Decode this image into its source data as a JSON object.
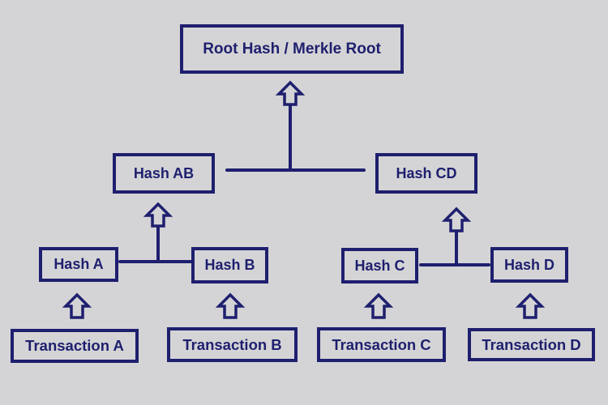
{
  "diagram": {
    "type": "merkle-tree",
    "colors": {
      "stroke": "#1e1f6e",
      "text": "#1e1f6e",
      "background": "#d4d4d6"
    },
    "nodes": {
      "root": "Root Hash / Merkle Root",
      "hash_ab": "Hash AB",
      "hash_cd": "Hash CD",
      "hash_a": "Hash A",
      "hash_b": "Hash B",
      "hash_c": "Hash C",
      "hash_d": "Hash D",
      "tx_a": "Transaction A",
      "tx_b": "Transaction B",
      "tx_c": "Transaction C",
      "tx_d": "Transaction D"
    },
    "edges": [
      {
        "from": [
          "hash_ab",
          "hash_cd"
        ],
        "to": "root"
      },
      {
        "from": [
          "hash_a",
          "hash_b"
        ],
        "to": "hash_ab"
      },
      {
        "from": [
          "hash_c",
          "hash_d"
        ],
        "to": "hash_cd"
      },
      {
        "from": [
          "tx_a"
        ],
        "to": "hash_a"
      },
      {
        "from": [
          "tx_b"
        ],
        "to": "hash_b"
      },
      {
        "from": [
          "tx_c"
        ],
        "to": "hash_c"
      },
      {
        "from": [
          "tx_d"
        ],
        "to": "hash_d"
      }
    ]
  }
}
